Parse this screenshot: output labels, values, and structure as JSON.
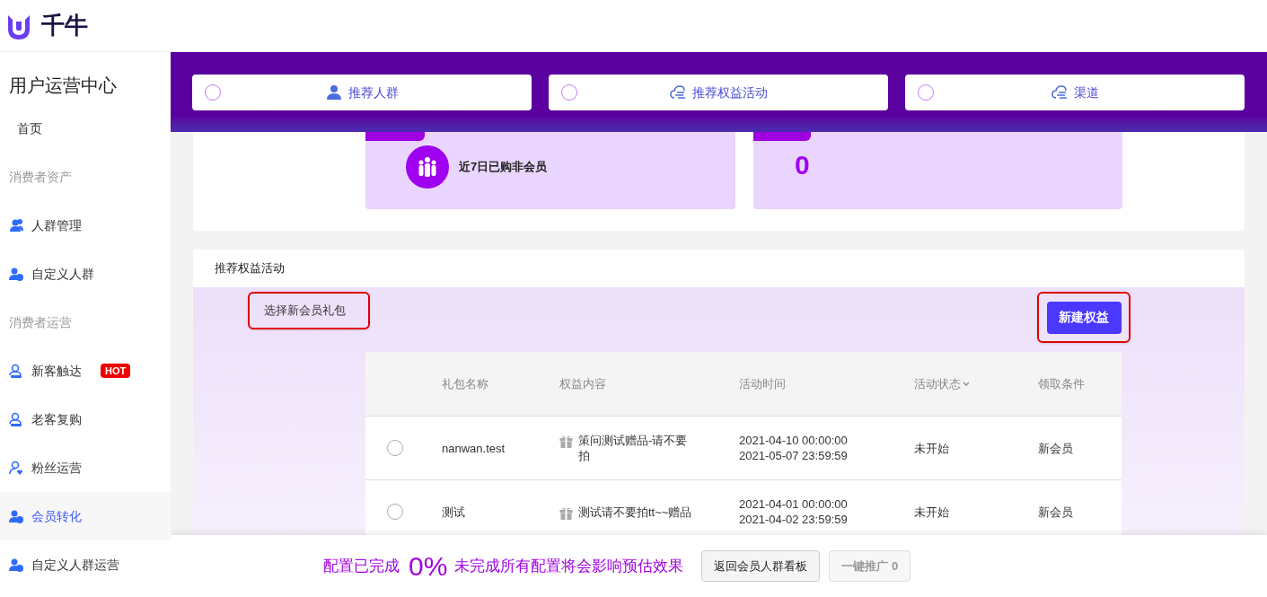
{
  "logo": {
    "text": "千牛"
  },
  "sidebar": {
    "title": "用户运营中心",
    "items": [
      {
        "kind": "link",
        "label": "首页",
        "selected": false
      },
      {
        "kind": "section",
        "label": "消费者资产"
      },
      {
        "kind": "icon-link",
        "label": "人群管理",
        "selected": false
      },
      {
        "kind": "icon-link",
        "label": "自定义人群",
        "selected": false
      },
      {
        "kind": "section",
        "label": "消费者运营"
      },
      {
        "kind": "icon-link",
        "label": "新客触达",
        "badge": "HOT",
        "selected": false
      },
      {
        "kind": "icon-link",
        "label": "老客复购",
        "selected": false
      },
      {
        "kind": "icon-link",
        "label": "粉丝运营",
        "selected": false
      },
      {
        "kind": "icon-link",
        "label": "会员转化",
        "selected": true
      },
      {
        "kind": "icon-link",
        "label": "自定义人群运营",
        "selected": false
      }
    ]
  },
  "steps": [
    {
      "label": "推荐人群",
      "selected": false
    },
    {
      "label": "推荐权益活动",
      "selected": false
    },
    {
      "label": "渠道",
      "selected": false
    }
  ],
  "audience": {
    "name": "近7日已购非会员",
    "scale": "0"
  },
  "benefits": {
    "title": "推荐权益活动",
    "prompt": "选择新会员礼包",
    "new_button": "新建权益",
    "table": {
      "columns": [
        "礼包名称",
        "权益内容",
        "活动时间",
        "活动状态",
        "领取条件"
      ],
      "rows": [
        {
          "selected": false,
          "name": "nanwan.test",
          "content": "策问测试赠品-请不要拍",
          "time": "2021-04-10 00:00:00\n2021-05-07 23:59:59",
          "status": "未开始",
          "condition": "新会员"
        },
        {
          "selected": false,
          "name": "测试",
          "content": "测试请不要拍tt~~赠品",
          "time": "2021-04-01 00:00:00\n2021-04-02 23:59:59",
          "status": "未开始",
          "condition": "新会员"
        }
      ]
    }
  },
  "footer": {
    "done_label": "配置已完成",
    "percent": "0%",
    "warning": "未完成所有配置将会影响预估效果",
    "back_button": "返回会员人群看板",
    "promote_button": {
      "label": "一键推广 0",
      "disabled": true
    }
  }
}
